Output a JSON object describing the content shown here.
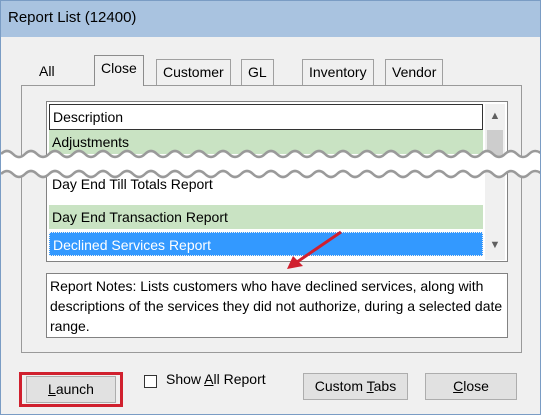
{
  "window": {
    "title": "Report List (12400)"
  },
  "tabs": [
    {
      "label": "All",
      "active": false
    },
    {
      "label": "Close",
      "active": true
    },
    {
      "label": "Customer",
      "active": false
    },
    {
      "label": "GL",
      "active": false
    },
    {
      "label": "Inventory",
      "active": false
    },
    {
      "label": "Vendor",
      "active": false
    }
  ],
  "list": {
    "header": "Description",
    "top_items": [
      "Adjustments"
    ],
    "bottom_items": [
      "Day End Till Totals Report",
      "Day End Transaction Report",
      "Declined Services Report"
    ]
  },
  "notes": {
    "text": "Report Notes:  Lists customers who have declined services, along with descriptions of the services they did not authorize, during a selected date range."
  },
  "buttons": {
    "launch_pre": "",
    "launch_ul": "L",
    "launch_post": "aunch",
    "show_pre": "Show ",
    "show_ul": "A",
    "show_post": "ll Report",
    "tabs_pre": "Custom ",
    "tabs_ul": "T",
    "tabs_post": "abs",
    "close_pre": "",
    "close_ul": "C",
    "close_post": "lose"
  },
  "colors": {
    "highlight_row": "#c9e3c3",
    "selected_row": "#3399ff",
    "annotation_red": "#d0202e"
  }
}
